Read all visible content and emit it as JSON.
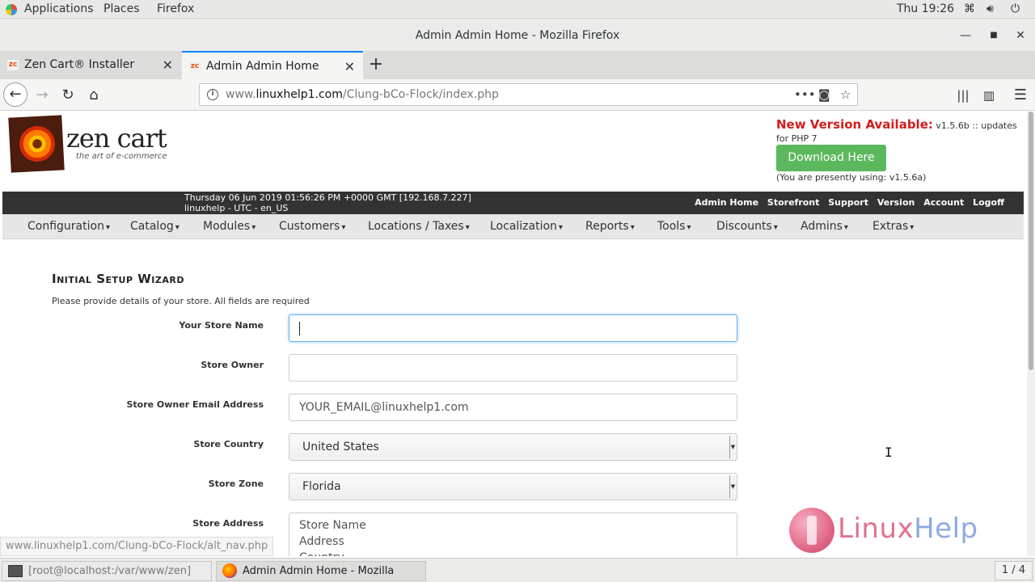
{
  "topbar": {
    "applications": "Applications",
    "places": "Places",
    "firefox": "Firefox",
    "clock": "Thu 19:26",
    "network_icon": "network-icon",
    "volume_icon": "volume-icon",
    "power_icon": "power-icon"
  },
  "window": {
    "title": "Admin Admin Home - Mozilla Firefox"
  },
  "tabs": [
    {
      "favicon": "zc",
      "label": "Zen Cart® Installer",
      "active": false
    },
    {
      "favicon": "zc",
      "label": "Admin Admin Home",
      "active": true
    }
  ],
  "urlbar": {
    "prefix": "www.",
    "domain": "linuxhelp1.com",
    "path": "/Clung-bCo-Flock/index.php"
  },
  "header": {
    "logo_text": "zen cart",
    "logo_tagline": "the art of e-commerce",
    "version_headline": "New Version Available:",
    "version_detail": " v1.5.6b :: updates for PHP 7",
    "download_label": "Download Here",
    "using_text": "(You are presently using: v1.5.6a)"
  },
  "adminbar": {
    "datetime": "Thursday 06 Jun 2019 01:56:26 PM +0000 GMT [192.168.7.227]",
    "locale": "linuxhelp - UTC - en_US",
    "links": [
      "Admin Home",
      "Storefront",
      "Support",
      "Version",
      "Account",
      "Logoff"
    ]
  },
  "nav": {
    "items": [
      "Configuration",
      "Catalog",
      "Modules",
      "Customers",
      "Locations / Taxes",
      "Localization",
      "Reports",
      "Tools",
      "Discounts",
      "Admins",
      "Extras"
    ]
  },
  "wizard": {
    "title": "Initial Setup Wizard",
    "description": "Please provide details of your store. All fields are required",
    "fields": {
      "store_name": {
        "label": "Your Store Name",
        "value": ""
      },
      "store_owner": {
        "label": "Store Owner",
        "value": ""
      },
      "owner_email": {
        "label": "Store Owner Email Address",
        "value": "YOUR_EMAIL@linuxhelp1.com"
      },
      "country": {
        "label": "Store Country",
        "value": "United States"
      },
      "zone": {
        "label": "Store Zone",
        "value": "Florida"
      },
      "address": {
        "label": "Store Address",
        "lines": [
          "Store Name",
          "Address",
          "Country"
        ]
      }
    }
  },
  "status_url": "www.linuxhelp1.com/Clung-bCo-Flock/alt_nav.php",
  "watermark": {
    "part1": "Linux",
    "part2": "Help"
  },
  "taskbar": {
    "terminal": "[root@localhost:/var/www/zen]",
    "firefox": "Admin Admin Home - Mozilla Firefox",
    "workspace": "1 / 4"
  }
}
